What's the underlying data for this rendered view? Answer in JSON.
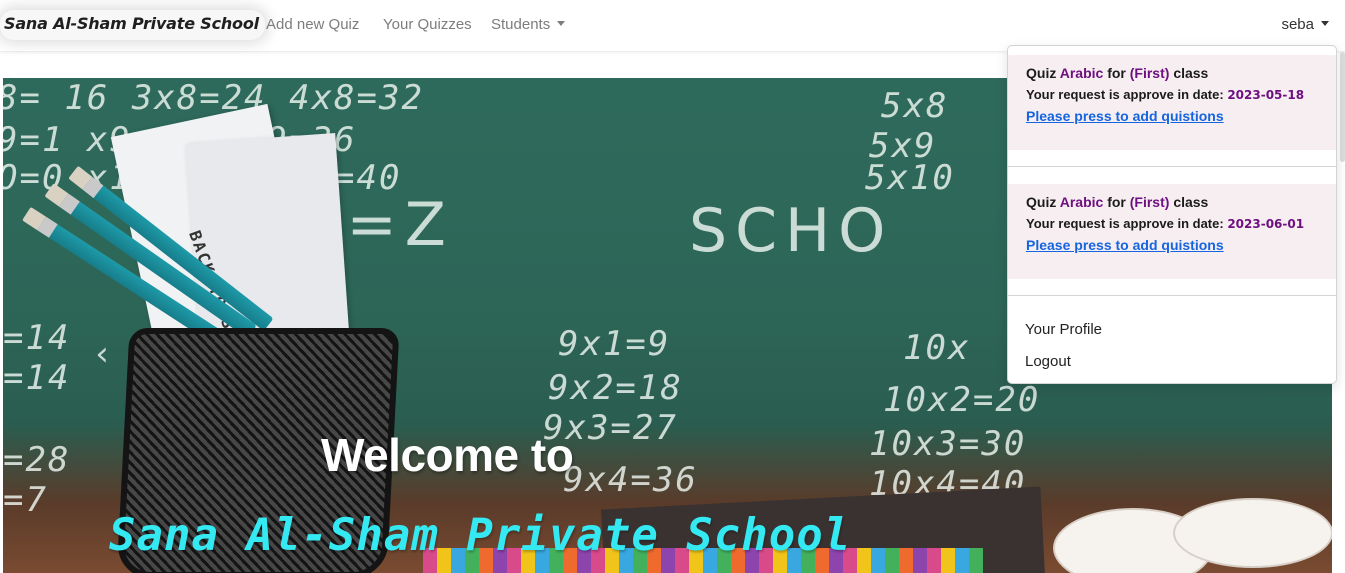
{
  "navbar": {
    "brand": "Sana Al-Sham Private School",
    "links": [
      {
        "label": "Add new Quiz"
      },
      {
        "label": "Your Quizzes"
      },
      {
        "label": "Students"
      }
    ],
    "user": "seba"
  },
  "hero": {
    "welcome": "Welcome to",
    "school_name": "Sana Al-Sham Private School",
    "board_text": {
      "line1": "8= 16   3x8=24    4x8=32",
      "line2": "9=1    x9=27    4x9=36",
      "line3": "O=0    x10=30   4x10=40",
      "right1": "5x8",
      "right2": "5x9",
      "right3": "5x10",
      "scribble_left": "y=Z",
      "scribble_right": "SCHO",
      "mid1": "9x1=9",
      "mid2": "9x2=18",
      "mid3": "9x3=27",
      "mid4": "9x4=36",
      "right_mid1": "10x",
      "right_mid2": "10x2=20",
      "right_mid3": "10x3=30",
      "right_mid4": "10x4=40",
      "left_col1": "=14",
      "left_col2": "=14",
      "left_col3": "=28",
      "left_col4": "=7",
      "paper_text": "BACK TO SCHOO"
    }
  },
  "dropdown": {
    "notifications": [
      {
        "prefix": "Quiz",
        "subject": "Arabic",
        "for": "for",
        "class_name": "(First)",
        "suffix": "class",
        "message": "Your request is approve in date:",
        "date": "2023-05-18",
        "link": "Please press to add quistions"
      },
      {
        "prefix": "Quiz",
        "subject": "Arabic",
        "for": "for",
        "class_name": "(First)",
        "suffix": "class",
        "message": "Your request is approve in date:",
        "date": "2023-06-01",
        "link": "Please press to add quistions"
      }
    ],
    "menu": {
      "profile": "Your Profile",
      "logout": "Logout"
    }
  },
  "icons": {
    "carousel_prev": "chevron-left-icon",
    "caret": "caret-down-icon"
  },
  "colors": {
    "subject_accent": "#6f1081",
    "link": "#1565e0",
    "notification_bg": "#f7eef1",
    "school_title": "#34e9f2"
  }
}
